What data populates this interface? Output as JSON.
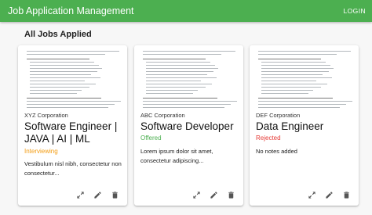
{
  "appbar": {
    "title": "Job Application Management",
    "login_label": "LOGIN",
    "color": "#4caf50"
  },
  "page": {
    "title": "All Jobs Applied"
  },
  "status_colors": {
    "Interviewing": "#f39c12",
    "Offered": "#4caf50",
    "Rejected": "#e53935"
  },
  "jobs": [
    {
      "company": "XYZ Corporation",
      "role": "Software Engineer | JAVA | AI | ML",
      "status": "Interviewing",
      "notes": "Vestibulum nisl nibh, consectetur non consectetur..."
    },
    {
      "company": "ABC Corporation",
      "role": "Software Developer",
      "status": "Offered",
      "notes": "Lorem ipsum dolor sit amet, consectetur adipiscing..."
    },
    {
      "company": "DEF Corporation",
      "role": "Data Engineer",
      "status": "Rejected",
      "notes": "No notes added"
    }
  ],
  "card_actions": [
    "expand-icon",
    "edit-icon",
    "delete-icon"
  ]
}
